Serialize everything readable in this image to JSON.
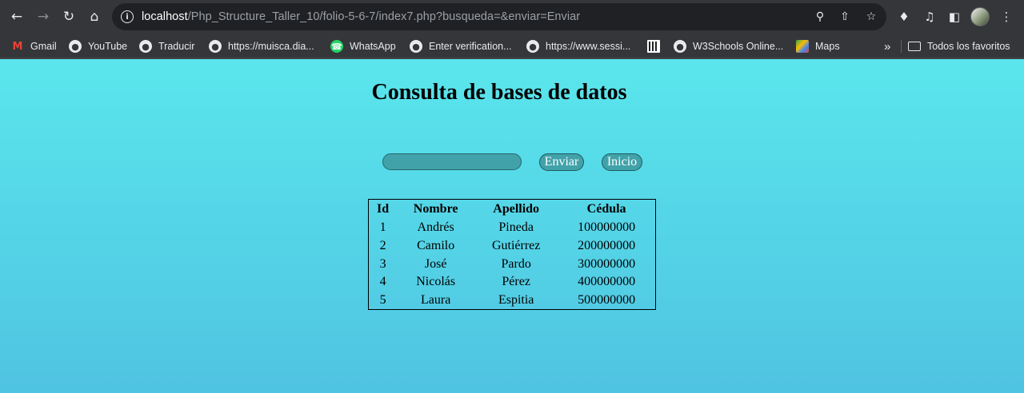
{
  "browser": {
    "url_host": "localhost",
    "url_path": "/Php_Structure_Taller_10/folio-5-6-7/index7.php?busqueda=&enviar=Enviar"
  },
  "bookmarks": {
    "items": [
      {
        "label": "Gmail",
        "icon": "gmail-icon"
      },
      {
        "label": "YouTube",
        "icon": "globe-icon"
      },
      {
        "label": "Traducir",
        "icon": "globe-icon"
      },
      {
        "label": "https://muisca.dia...",
        "icon": "globe-icon"
      },
      {
        "label": "WhatsApp",
        "icon": "whatsapp-icon"
      },
      {
        "label": "Enter verification...",
        "icon": "globe-icon"
      },
      {
        "label": "https://www.sessi...",
        "icon": "globe-icon"
      },
      {
        "label": "",
        "icon": "qr-icon"
      },
      {
        "label": "W3Schools Online...",
        "icon": "globe-icon"
      },
      {
        "label": "Maps",
        "icon": "maps-icon"
      }
    ],
    "overflow": "»",
    "all_bookmarks": "Todos los favoritos"
  },
  "page": {
    "title": "Consulta de bases de datos",
    "search_value": "",
    "enviar_label": "Enviar",
    "inicio_label": "Inicio",
    "table": {
      "headers": [
        "Id",
        "Nombre",
        "Apellido",
        "Cédula"
      ],
      "rows": [
        [
          "1",
          "Andrés",
          "Pineda",
          "100000000"
        ],
        [
          "2",
          "Camilo",
          "Gutiérrez",
          "200000000"
        ],
        [
          "3",
          "José",
          "Pardo",
          "300000000"
        ],
        [
          "4",
          "Nicolás",
          "Pérez",
          "400000000"
        ],
        [
          "5",
          "Laura",
          "Espitia",
          "500000000"
        ]
      ]
    }
  }
}
